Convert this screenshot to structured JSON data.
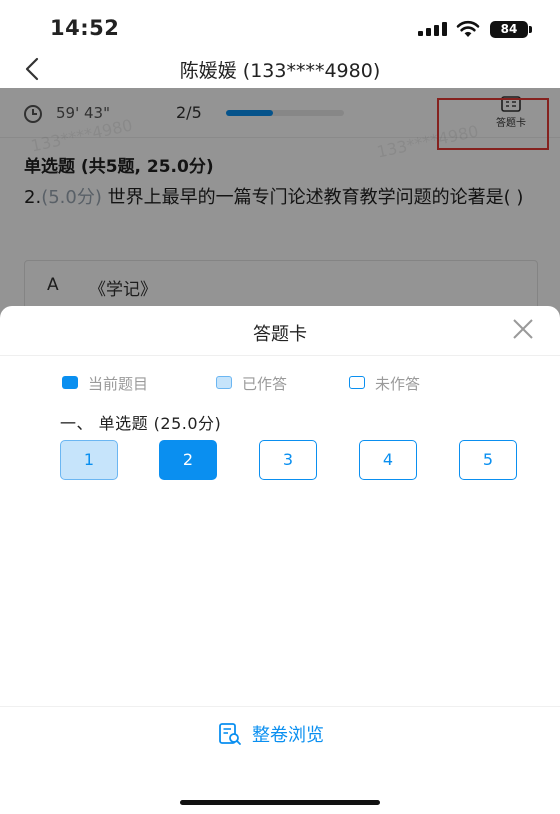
{
  "status_bar": {
    "time": "14:52",
    "battery": "84"
  },
  "nav": {
    "back_symbol": "<",
    "title": "陈媛媛 (133****4980)"
  },
  "exam": {
    "timer": "59' 43\"",
    "progress_text": "2/5",
    "progress_fraction": 0.4,
    "answer_card_label": "答题卡",
    "section_heading": "单选题 (共5题, 25.0分)",
    "question_number": "2.",
    "question_score": "(5.0分)",
    "question_text": "世界上最早的一篇专门论述教育教学问题的论著是(    )",
    "option_a_letter": "A",
    "option_a_text": "《学记》",
    "watermark": "133****4980"
  },
  "sheet": {
    "title": "答题卡",
    "legend": {
      "current": "当前题目",
      "answered": "已作答",
      "unanswered": "未作答"
    },
    "group_title": "一、 单选题 (25.0分)",
    "questions": [
      {
        "label": "1",
        "state": "answered"
      },
      {
        "label": "2",
        "state": "current"
      },
      {
        "label": "3",
        "state": "unanswered"
      },
      {
        "label": "4",
        "state": "unanswered"
      },
      {
        "label": "5",
        "state": "unanswered"
      }
    ],
    "browse_label": "整卷浏览"
  },
  "colors": {
    "accent": "#0a8ff0",
    "answered_fill": "#c6e4fb",
    "highlight": "#e53935"
  },
  "icons": [
    "signal-icon",
    "wifi-icon",
    "battery-icon",
    "back-icon",
    "clock-icon",
    "answer-card-icon",
    "close-icon",
    "browse-icon"
  ]
}
